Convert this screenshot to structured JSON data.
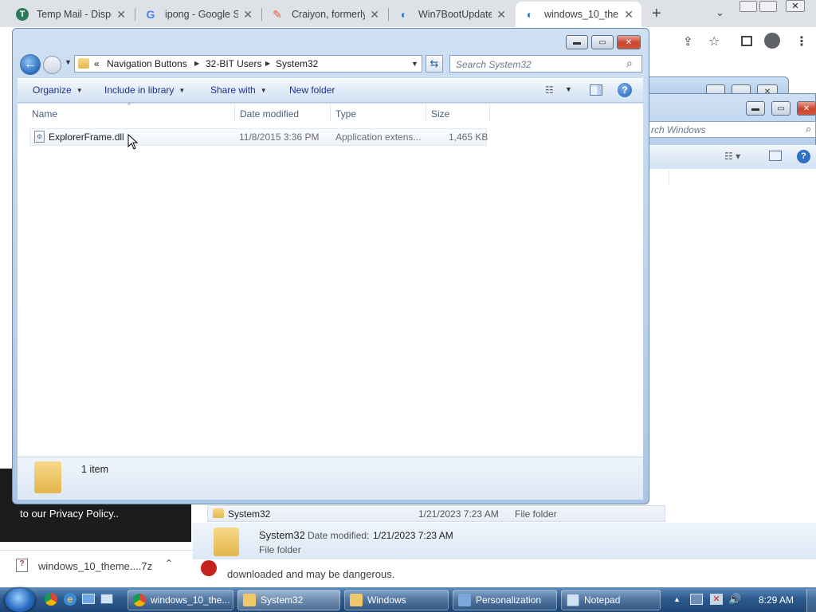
{
  "browser": {
    "tabs": [
      {
        "title": "Temp Mail - Dispo",
        "icon": "tempmail-icon",
        "color": "#2b7a5a"
      },
      {
        "title": "ipong - Google Se",
        "icon": "google-icon",
        "color": "#4285f4"
      },
      {
        "title": "Craiyon, formerly",
        "icon": "craiyon-pencil-icon",
        "color": "#e8592c"
      },
      {
        "title": "Win7BootUpdater",
        "icon": "win7bootupdater-icon",
        "color": "#3a79c9"
      },
      {
        "title": "windows_10_them",
        "icon": "win7bootupdater-icon",
        "color": "#3a79c9",
        "active": true
      }
    ],
    "new_tab_glyph": "+",
    "close_glyph": "✕"
  },
  "explorer": {
    "breadcrumb": [
      "Navigation Buttons",
      "32-BIT Users",
      "System32"
    ],
    "overflow": "«",
    "search_placeholder": "Search System32",
    "toolbar": {
      "organize": "Organize",
      "include": "Include in library",
      "share": "Share with",
      "new_folder": "New folder"
    },
    "columns": {
      "name": "Name",
      "date": "Date modified",
      "type": "Type",
      "size": "Size"
    },
    "files": [
      {
        "name": "ExplorerFrame.dll",
        "date": "11/8/2015 3:36 PM",
        "type": "Application extens...",
        "size": "1,465 KB"
      }
    ],
    "status": "1 item",
    "help": "?"
  },
  "back_window": {
    "search_partial": "rch Windows",
    "row": {
      "name": "System32",
      "date": "1/21/2023 7:23 AM",
      "type": "File folder"
    },
    "details": {
      "name": "System32",
      "date_label": "Date modified:",
      "date": "1/21/2023 7:23 AM",
      "type": "File folder"
    }
  },
  "page_behind": {
    "privacy": "to our Privacy Policy..",
    "warning": "downloaded and may be dangerous."
  },
  "download": {
    "filename": "windows_10_theme....7z"
  },
  "taskbar": {
    "items": [
      {
        "label": "windows_10_the...",
        "color": "#e8c54a"
      },
      {
        "label": "System32",
        "color": "#f0c86a"
      },
      {
        "label": "Windows",
        "color": "#f0c86a"
      },
      {
        "label": "Personalization",
        "color": "#7aa8d8"
      },
      {
        "label": "Notepad",
        "color": "#cfe3f5"
      }
    ],
    "clock": "8:29 AM"
  }
}
